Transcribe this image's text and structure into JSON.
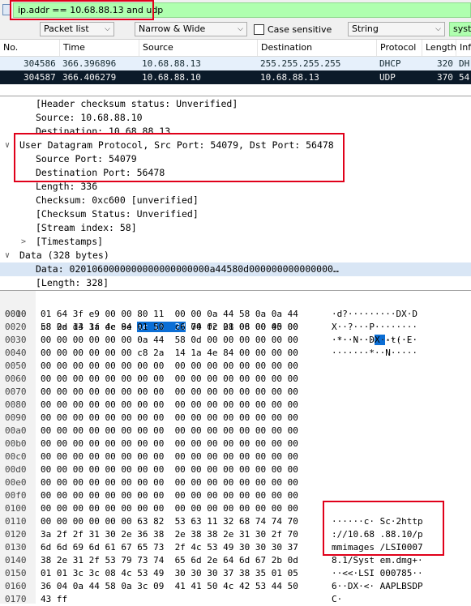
{
  "filter": {
    "text": "ip.addr == 10.68.88.13 and udp"
  },
  "toolbar": {
    "search_in": "Packet list",
    "char_width": "Narrow & Wide",
    "case_sensitive_label": "Case sensitive",
    "search_type": "String",
    "search_value": "syste"
  },
  "packet_list": {
    "columns": [
      "No.",
      "Time",
      "Source",
      "Destination",
      "Protocol",
      "Length",
      "Inf"
    ],
    "rows": [
      {
        "no": "304586",
        "time": "366.396896",
        "source": "10.68.88.13",
        "destination": "255.255.255.255",
        "protocol": "DHCP",
        "length": "320",
        "info": "DH"
      },
      {
        "no": "304587",
        "time": "366.406279",
        "source": "10.68.88.10",
        "destination": "10.68.88.13",
        "protocol": "UDP",
        "length": "370",
        "info": "54"
      }
    ]
  },
  "details": [
    {
      "text": "[Header checksum status: Unverified]"
    },
    {
      "text": "Source: 10.68.88.10"
    },
    {
      "text": "Destination: 10.68.88.13"
    },
    {
      "text": "User Datagram Protocol, Src Port: 54079, Dst Port: 56478",
      "twisty": "∨"
    },
    {
      "text": "Source Port: 54079"
    },
    {
      "text": "Destination Port: 56478"
    },
    {
      "text": "Length: 336"
    },
    {
      "text": "Checksum: 0xc600 [unverified]"
    },
    {
      "text": "[Checksum Status: Unverified]"
    },
    {
      "text": "[Stream index: 58]"
    },
    {
      "text": "[Timestamps]",
      "twisty": ">"
    },
    {
      "text": "Data (328 bytes)",
      "twisty": "∨"
    },
    {
      "text": "Data: 0201060000000000000000000a44580d000000000000000…"
    },
    {
      "text": "[Length: 328]"
    }
  ],
  "hex": [
    {
      "off": "0000",
      "pre": "c8 2a 14 1a 4e 84 ",
      "hi": "ac 16  2d",
      "post": " 74 fc 28 08 00 45 00",
      "apre": "·*··N···",
      "ahi": "··",
      "apost": "-t(·E·"
    },
    {
      "off": "0010",
      "bytes": "01 64 3f e9 00 00 80 11  00 00 0a 44 58 0a 0a 44",
      "ascii": "·d?·········DX·D"
    },
    {
      "off": "0020",
      "bytes": "58 0d d3 3f dc 9e 01 50  c6 00 02 01 06 00 00 00",
      "ascii": "X··?···P········"
    },
    {
      "off": "0030",
      "bytes": "00 00 00 00 00 00 0a 44  58 0d 00 00 00 00 00 00",
      "ascii": "·······DX·······"
    },
    {
      "off": "0040",
      "bytes": "00 00 00 00 00 00 c8 2a  14 1a 4e 84 00 00 00 00",
      "ascii": "·······*··N·····"
    },
    {
      "off": "0050",
      "bytes": "00 00 00 00 00 00 00 00  00 00 00 00 00 00 00 00",
      "ascii": ""
    },
    {
      "off": "0060",
      "bytes": "00 00 00 00 00 00 00 00  00 00 00 00 00 00 00 00",
      "ascii": ""
    },
    {
      "off": "0070",
      "bytes": "00 00 00 00 00 00 00 00  00 00 00 00 00 00 00 00",
      "ascii": ""
    },
    {
      "off": "0080",
      "bytes": "00 00 00 00 00 00 00 00  00 00 00 00 00 00 00 00",
      "ascii": ""
    },
    {
      "off": "0090",
      "bytes": "00 00 00 00 00 00 00 00  00 00 00 00 00 00 00 00",
      "ascii": ""
    },
    {
      "off": "00a0",
      "bytes": "00 00 00 00 00 00 00 00  00 00 00 00 00 00 00 00",
      "ascii": ""
    },
    {
      "off": "00b0",
      "bytes": "00 00 00 00 00 00 00 00  00 00 00 00 00 00 00 00",
      "ascii": ""
    },
    {
      "off": "00c0",
      "bytes": "00 00 00 00 00 00 00 00  00 00 00 00 00 00 00 00",
      "ascii": ""
    },
    {
      "off": "00d0",
      "bytes": "00 00 00 00 00 00 00 00  00 00 00 00 00 00 00 00",
      "ascii": ""
    },
    {
      "off": "00e0",
      "bytes": "00 00 00 00 00 00 00 00  00 00 00 00 00 00 00 00",
      "ascii": ""
    },
    {
      "off": "00f0",
      "bytes": "00 00 00 00 00 00 00 00  00 00 00 00 00 00 00 00",
      "ascii": ""
    },
    {
      "off": "0100",
      "bytes": "00 00 00 00 00 00 00 00  00 00 00 00 00 00 00 00",
      "ascii": ""
    },
    {
      "off": "0110",
      "bytes": "00 00 00 00 00 00 63 82  53 63 11 32 68 74 74 70",
      "ascii": "······c· Sc·2http"
    },
    {
      "off": "0120",
      "bytes": "3a 2f 2f 31 30 2e 36 38  2e 38 38 2e 31 30 2f 70",
      "ascii": "://10.68 .88.10/p"
    },
    {
      "off": "0130",
      "bytes": "6d 6d 69 6d 61 67 65 73  2f 4c 53 49 30 30 30 37",
      "ascii": "mmimages /LSI0007"
    },
    {
      "off": "0140",
      "bytes": "38 2e 31 2f 53 79 73 74  65 6d 2e 64 6d 67 2b 0d",
      "ascii": "8.1/Syst em.dmg+·"
    },
    {
      "off": "0150",
      "bytes": "01 01 3c 3c 08 4c 53 49  30 30 30 37 38 35 01 05",
      "ascii": "··<<·LSI 000785··"
    },
    {
      "off": "0160",
      "bytes": "36 04 0a 44 58 0a 3c 09  41 41 50 4c 42 53 44 50",
      "ascii": "6··DX·<· AAPLBSDP"
    },
    {
      "off": "0170",
      "bytes": "43 ff",
      "ascii": "C·"
    }
  ]
}
